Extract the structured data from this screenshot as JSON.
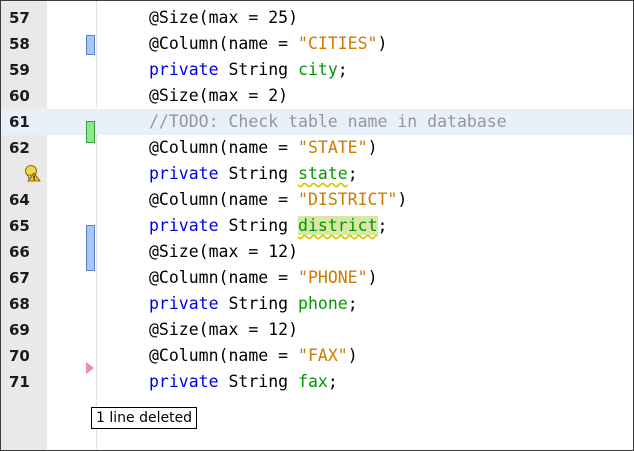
{
  "lines": [
    {
      "num": "57",
      "tokens": [
        {
          "t": "@Size(max = 25)",
          "c": ""
        }
      ]
    },
    {
      "num": "58",
      "tokens": [
        {
          "t": "@Column(name = ",
          "c": ""
        },
        {
          "t": "\"CITIES\"",
          "c": "str"
        },
        {
          "t": ")",
          "c": ""
        }
      ]
    },
    {
      "num": "59",
      "tokens": [
        {
          "t": "private",
          "c": "kw"
        },
        {
          "t": " String ",
          "c": ""
        },
        {
          "t": "city",
          "c": "fld"
        },
        {
          "t": ";",
          "c": ""
        }
      ]
    },
    {
      "num": "60",
      "tokens": [
        {
          "t": "@Size(max = 2)",
          "c": ""
        }
      ]
    },
    {
      "num": "61",
      "tokens": [
        {
          "t": "//TODO: Check table name in database",
          "c": "cmt"
        }
      ]
    },
    {
      "num": "62",
      "tokens": [
        {
          "t": "@Column(name = ",
          "c": ""
        },
        {
          "t": "\"STATE\"",
          "c": "str"
        },
        {
          "t": ")",
          "c": ""
        }
      ]
    },
    {
      "num": "",
      "tokens": [
        {
          "t": "private",
          "c": "kw"
        },
        {
          "t": " String ",
          "c": ""
        },
        {
          "t": "state",
          "c": "fld warn"
        },
        {
          "t": ";",
          "c": ""
        }
      ]
    },
    {
      "num": "64",
      "tokens": [
        {
          "t": "@Column(name = ",
          "c": ""
        },
        {
          "t": "\"DISTRICT\"",
          "c": "str"
        },
        {
          "t": ")",
          "c": ""
        }
      ]
    },
    {
      "num": "65",
      "tokens": [
        {
          "t": "private",
          "c": "kw"
        },
        {
          "t": " String ",
          "c": ""
        },
        {
          "t": "district",
          "c": "fld warn hl"
        },
        {
          "t": ";",
          "c": ""
        }
      ]
    },
    {
      "num": "66",
      "tokens": [
        {
          "t": "@Size(max = 12)",
          "c": ""
        }
      ]
    },
    {
      "num": "67",
      "tokens": [
        {
          "t": "@Column(name = ",
          "c": ""
        },
        {
          "t": "\"PHONE\"",
          "c": "str"
        },
        {
          "t": ")",
          "c": ""
        }
      ]
    },
    {
      "num": "68",
      "tokens": [
        {
          "t": "private",
          "c": "kw"
        },
        {
          "t": " String ",
          "c": ""
        },
        {
          "t": "phone",
          "c": "fld"
        },
        {
          "t": ";",
          "c": ""
        }
      ]
    },
    {
      "num": "69",
      "tokens": [
        {
          "t": "@Size(max = 12)",
          "c": ""
        }
      ]
    },
    {
      "num": "70",
      "tokens": [
        {
          "t": "@Column(name = ",
          "c": ""
        },
        {
          "t": "\"FAX\"",
          "c": "str"
        },
        {
          "t": ")",
          "c": ""
        }
      ]
    },
    {
      "num": "71",
      "tokens": [
        {
          "t": "private",
          "c": "kw"
        },
        {
          "t": " String ",
          "c": ""
        },
        {
          "t": "fax",
          "c": "fld"
        },
        {
          "t": ";",
          "c": ""
        }
      ]
    }
  ],
  "current_line": "61",
  "warning_line_icon": "warning-lightbulb-icon",
  "tooltip": {
    "text": "1 line deleted"
  },
  "gutter_marks": [
    {
      "type": "changed",
      "color": "#a9c6ef",
      "lines": "58"
    },
    {
      "type": "added",
      "color": "#8ce88c",
      "lines": "61"
    },
    {
      "type": "changed",
      "color": "#a9c6ef",
      "lines": "64-65"
    },
    {
      "type": "deleted",
      "color": "#f08da0",
      "lines": "69"
    }
  ],
  "colors": {
    "keyword": "#0000e6",
    "string": "#ce7b00",
    "comment": "#969696",
    "field": "#009900"
  }
}
